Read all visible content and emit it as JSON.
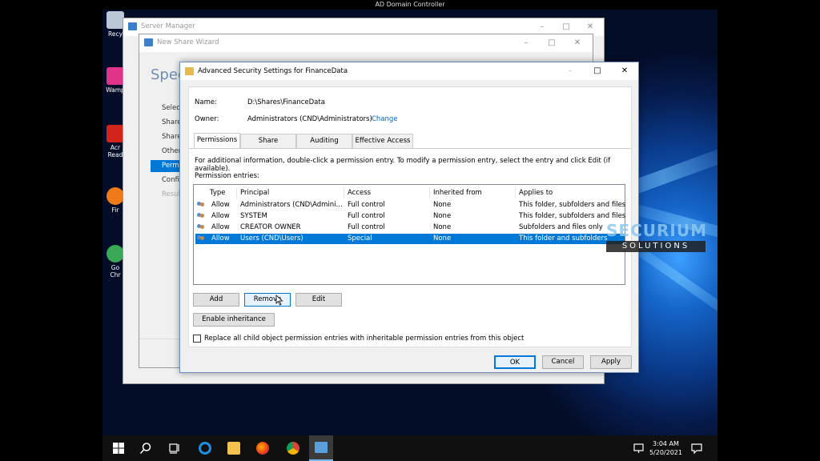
{
  "vm_title": "AD Domain Controller",
  "desktop_icons": [
    {
      "label": "Recy",
      "color": "#b9c7d6"
    },
    {
      "label": "Wamp",
      "color": "#e0338a"
    },
    {
      "label": "Acr Read",
      "color": "#d1241c"
    },
    {
      "label": "Fir",
      "color": "#f07a1a"
    },
    {
      "label": "Go Chr",
      "color": "#3aa757"
    }
  ],
  "server_manager": {
    "title": "Server Manager"
  },
  "wizard": {
    "title": "New Share Wizard",
    "heading": "Spec",
    "steps": [
      "Select",
      "Share",
      "Share",
      "Other",
      "Permi",
      "Confi",
      "Resul"
    ],
    "active_step": 4
  },
  "dialog": {
    "title": "Advanced Security Settings for FinanceData",
    "name_label": "Name:",
    "name_value": "D:\\Shares\\FinanceData",
    "owner_label": "Owner:",
    "owner_value": "Administrators (CND\\Administrators)",
    "owner_change": "Change",
    "tabs": [
      "Permissions",
      "Share",
      "Auditing",
      "Effective Access"
    ],
    "info_text": "For additional information, double-click a permission entry. To modify a permission entry, select the entry and click Edit (if available).",
    "entries_label": "Permission entries:",
    "columns": [
      "Type",
      "Principal",
      "Access",
      "Inherited from",
      "Applies to"
    ],
    "rows": [
      {
        "type": "Allow",
        "principal": "Administrators (CND\\Admini...",
        "access": "Full control",
        "inherited": "None",
        "applies": "This folder, subfolders and files"
      },
      {
        "type": "Allow",
        "principal": "SYSTEM",
        "access": "Full control",
        "inherited": "None",
        "applies": "This folder, subfolders and files"
      },
      {
        "type": "Allow",
        "principal": "CREATOR OWNER",
        "access": "Full control",
        "inherited": "None",
        "applies": "Subfolders and files only"
      },
      {
        "type": "Allow",
        "principal": "Users (CND\\Users)",
        "access": "Special",
        "inherited": "None",
        "applies": "This folder and subfolders"
      }
    ],
    "selected_row": 3,
    "buttons": {
      "add": "Add",
      "remove": "Remove",
      "edit": "Edit",
      "enable_inheritance": "Enable inheritance",
      "ok": "OK",
      "cancel": "Cancel",
      "apply": "Apply"
    },
    "replace_checkbox": "Replace all child object permission entries with inheritable permission entries from this object"
  },
  "watermark": {
    "top": "SECURIUM",
    "bottom": "SOLUTIONS"
  },
  "taskbar": {
    "time": "3:04 AM",
    "date": "5/20/2021"
  }
}
